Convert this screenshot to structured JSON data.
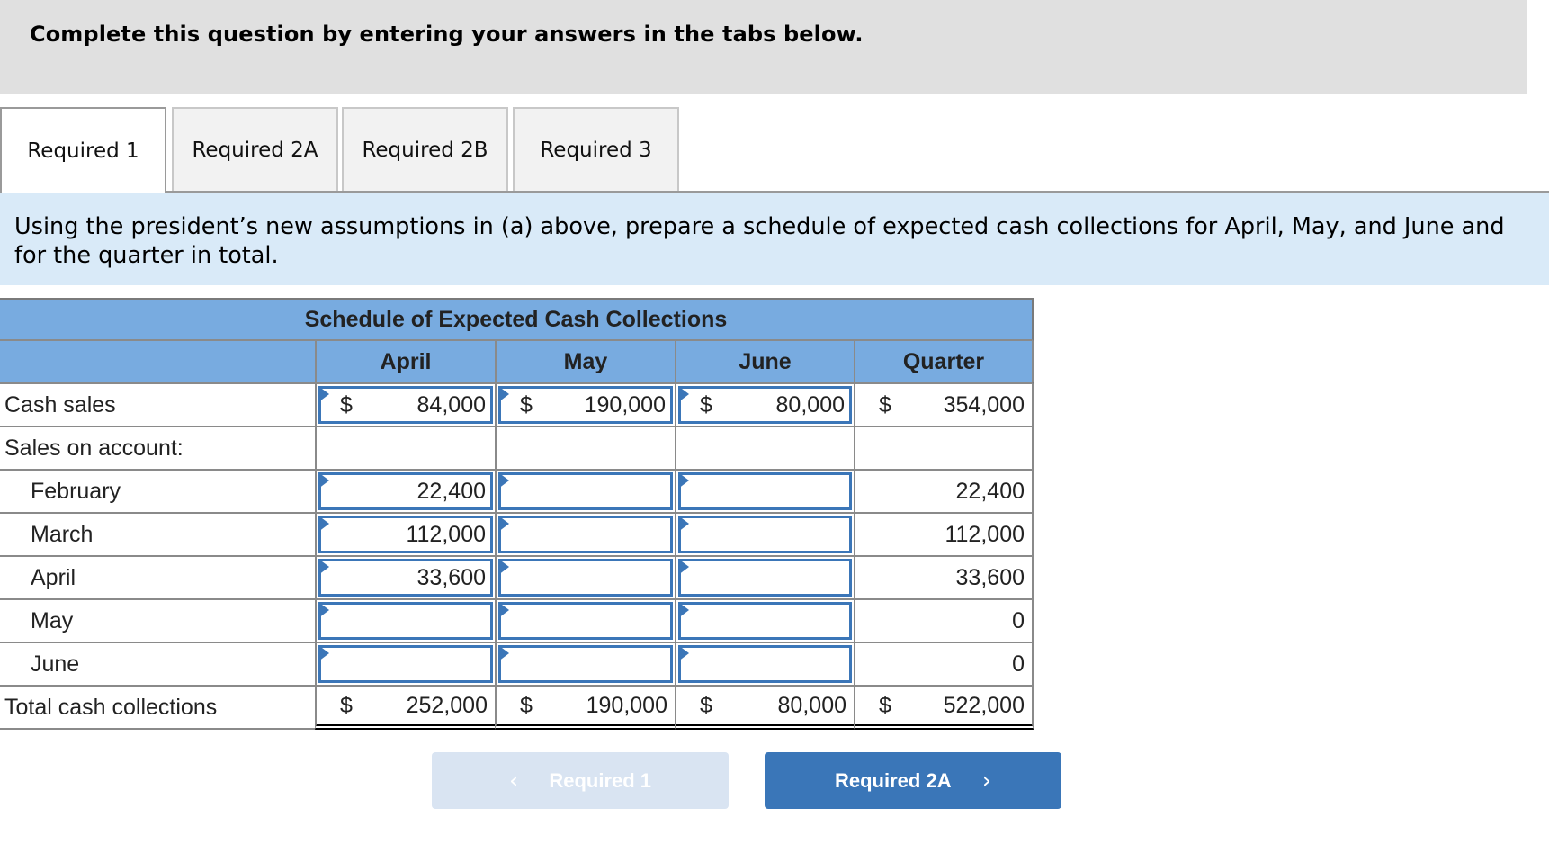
{
  "instruction": "Complete this question by entering your answers in the tabs below.",
  "tabs": [
    {
      "label": "Required 1",
      "active": true
    },
    {
      "label": "Required 2A",
      "active": false
    },
    {
      "label": "Required 2B",
      "active": false
    },
    {
      "label": "Required 3",
      "active": false
    }
  ],
  "prompt": "Using the president’s new assumptions in (a) above, prepare a schedule of expected cash collections for April, May, and June and for the quarter in total.",
  "schedule": {
    "title": "Schedule of Expected Cash Collections",
    "columns": [
      "April",
      "May",
      "June",
      "Quarter"
    ],
    "currency_symbol": "$",
    "rows": {
      "cash_sales": {
        "label": "Cash sales",
        "values": [
          "84,000",
          "190,000",
          "80,000",
          "354,000"
        ]
      },
      "sales_on_account": {
        "label": "Sales on account:"
      },
      "february": {
        "label": "February",
        "values": [
          "22,400",
          "",
          "",
          "22,400"
        ]
      },
      "march": {
        "label": "March",
        "values": [
          "112,000",
          "",
          "",
          "112,000"
        ]
      },
      "april": {
        "label": "April",
        "values": [
          "33,600",
          "",
          "",
          "33,600"
        ]
      },
      "may": {
        "label": "May",
        "values": [
          "",
          "",
          "",
          "0"
        ]
      },
      "june": {
        "label": "June",
        "values": [
          "",
          "",
          "",
          "0"
        ]
      },
      "total": {
        "label": "Total cash collections",
        "values": [
          "252,000",
          "190,000",
          "80,000",
          "522,000"
        ]
      }
    }
  },
  "nav": {
    "prev_label": "Required 1",
    "next_label": "Required 2A",
    "prev_icon": "chevron-left",
    "next_icon": "chevron-right"
  },
  "colors": {
    "header_blue": "#78abe0",
    "prompt_bg": "#d9eaf8",
    "input_border": "#3b76b8",
    "next_button": "#3a76b8",
    "prev_button_disabled": "#d9e4f2"
  }
}
